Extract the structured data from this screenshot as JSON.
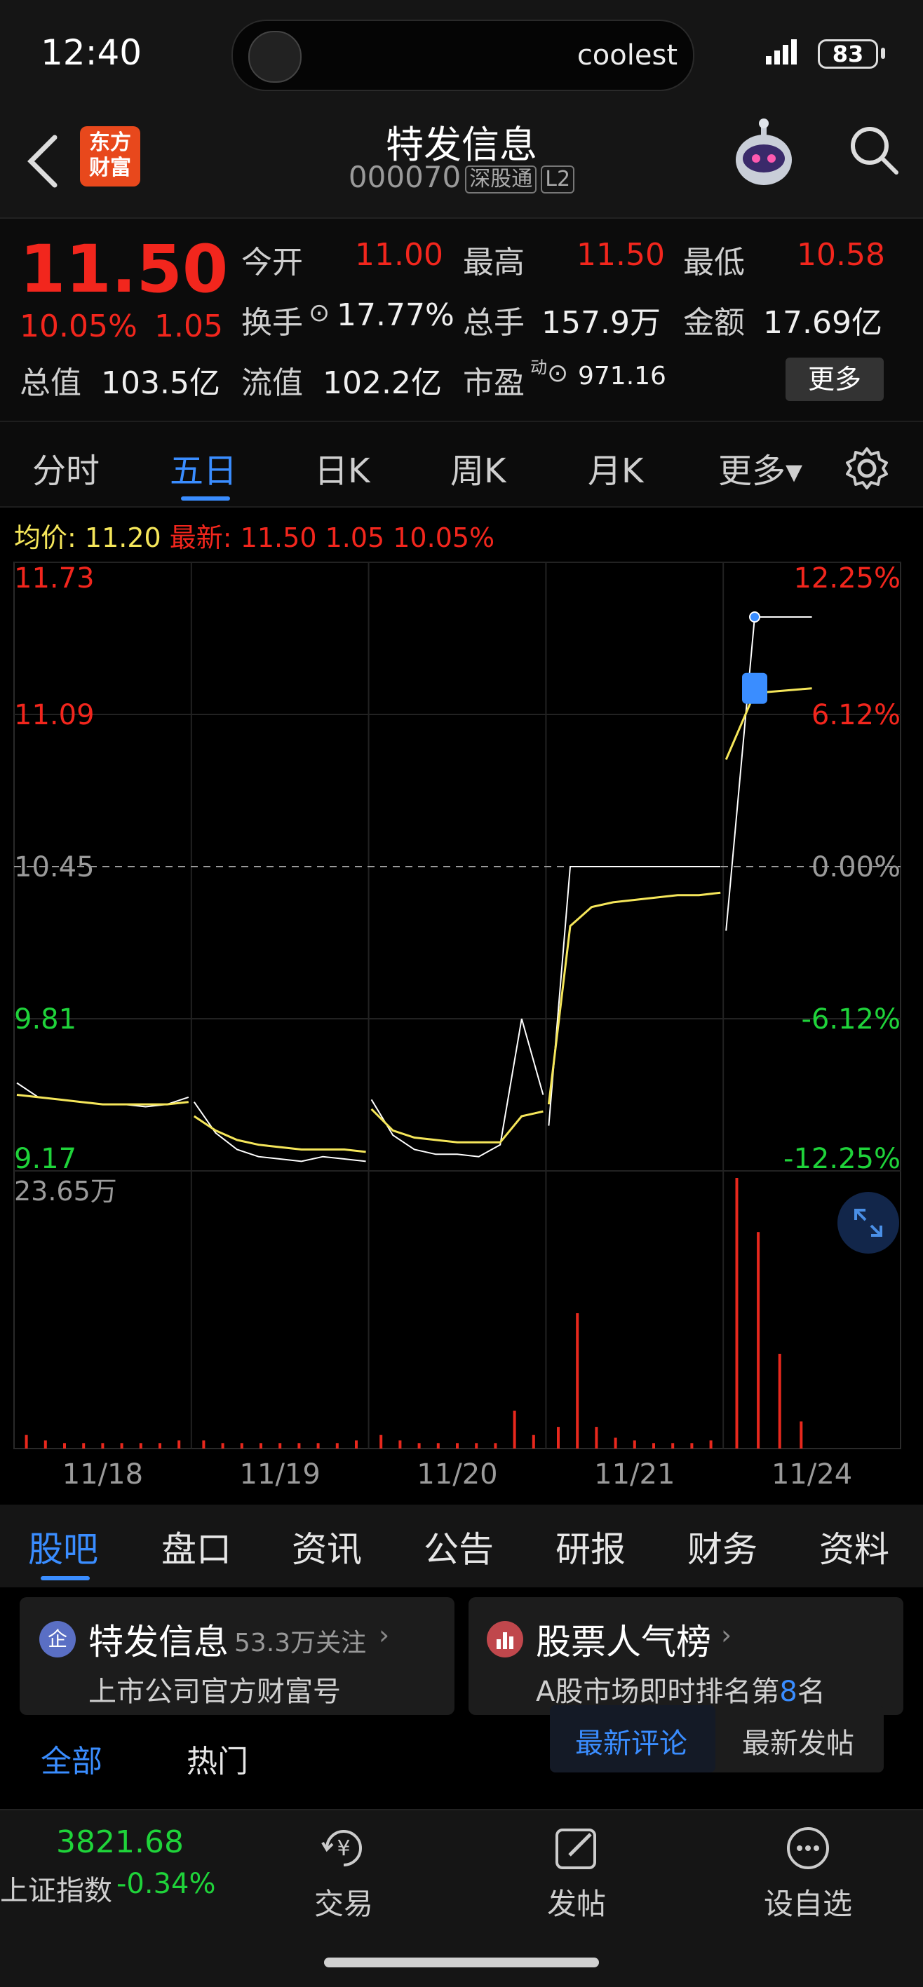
{
  "status_bar": {
    "time": "12:40",
    "island_text": "coolest",
    "battery": "83"
  },
  "header": {
    "logo_line1": "东方",
    "logo_line2": "财富",
    "title": "特发信息",
    "code": "000070",
    "tag1": "深股通",
    "tag2": "L2"
  },
  "quote": {
    "price": "11.50",
    "pct": "10.05%",
    "change": "1.05",
    "open_label": "今开",
    "open": "11.00",
    "high_label": "最高",
    "high": "11.50",
    "low_label": "最低",
    "low": "10.58",
    "turnover_label": "换手",
    "turnover": "17.77%",
    "volume_label": "总手",
    "volume": "157.9万",
    "amount_label": "金额",
    "amount": "17.69亿",
    "mktcap_label": "总值",
    "mktcap": "103.5亿",
    "float_label": "流值",
    "float": "102.2亿",
    "pe_label": "市盈",
    "pe_sup": "动",
    "pe": "971.16",
    "more": "更多"
  },
  "period_tabs": [
    "分时",
    "五日",
    "日K",
    "周K",
    "月K",
    "更多▾"
  ],
  "avg_line": {
    "avg_label": "均价:",
    "avg": "11.20",
    "latest_label": "最新:",
    "latest": "11.50 1.05 10.05%"
  },
  "chart_data": {
    "type": "line",
    "title": "",
    "x_labels": [
      "11/18",
      "11/19",
      "11/20",
      "11/21",
      "11/24"
    ],
    "y_left": [
      "11.73",
      "11.09",
      "10.45",
      "9.81",
      "9.17"
    ],
    "y_right": [
      "12.25%",
      "6.12%",
      "0.00%",
      "-6.12%",
      "-12.25%"
    ],
    "ylim": [
      9.17,
      11.73
    ],
    "prev_close": 10.45,
    "volume_max_label": "23.65万",
    "series": [
      {
        "name": "最新",
        "color": "#ffffff",
        "days": [
          [
            9.54,
            9.48,
            9.47,
            9.46,
            9.45,
            9.45,
            9.44,
            9.45,
            9.48
          ],
          [
            9.46,
            9.33,
            9.26,
            9.23,
            9.22,
            9.21,
            9.23,
            9.22,
            9.21
          ],
          [
            9.47,
            9.32,
            9.26,
            9.24,
            9.24,
            9.23,
            9.28,
            9.81,
            9.49
          ],
          [
            9.36,
            10.45,
            10.45,
            10.45,
            10.45,
            10.45,
            10.45,
            10.45,
            10.45
          ],
          [
            10.18,
            11.5,
            11.5,
            11.5
          ]
        ]
      },
      {
        "name": "均价",
        "color": "#f5e65a",
        "days": [
          [
            9.49,
            9.48,
            9.47,
            9.46,
            9.45,
            9.45,
            9.45,
            9.45,
            9.46
          ],
          [
            9.4,
            9.34,
            9.3,
            9.28,
            9.27,
            9.26,
            9.26,
            9.26,
            9.25
          ],
          [
            9.43,
            9.34,
            9.31,
            9.3,
            9.29,
            9.29,
            9.29,
            9.4,
            9.42
          ],
          [
            9.45,
            10.2,
            10.28,
            10.3,
            10.31,
            10.32,
            10.33,
            10.33,
            10.34
          ],
          [
            10.9,
            11.18,
            11.19,
            11.2
          ]
        ]
      }
    ]
  },
  "bottom_tabs": [
    "股吧",
    "盘口",
    "资讯",
    "公告",
    "研报",
    "财务",
    "资料"
  ],
  "cards": {
    "company_name": "特发信息",
    "company_follow": "53.3万关注",
    "company_sub": "上市公司官方财富号",
    "rank_title": "股票人气榜",
    "rank_sub_pre": "A股市场即时排名第",
    "rank_num": "8",
    "rank_sub_post": "名"
  },
  "sub_tabs": {
    "all": "全部",
    "hot": "热门",
    "latest_comment": "最新评论",
    "latest_post": "最新发帖"
  },
  "dock": {
    "index_value": "3821.68",
    "index_name": "上证指数",
    "index_change": "-0.34%",
    "trade": "交易",
    "post": "发帖",
    "watch": "设自选"
  }
}
